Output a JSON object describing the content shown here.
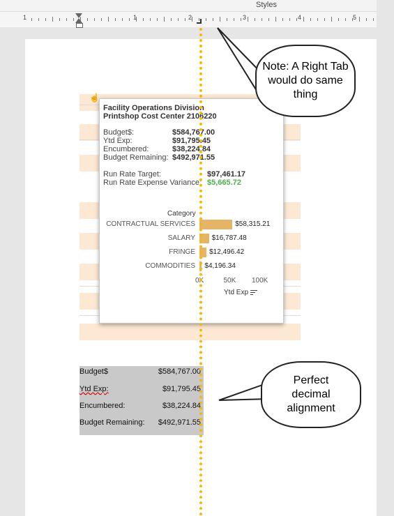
{
  "ribbon": {
    "styles_label": "Styles"
  },
  "ruler": {
    "numbers": [
      "1",
      "1",
      "2",
      "3",
      "4",
      "5"
    ]
  },
  "popup": {
    "title_line1": "Facility Operations Division",
    "title_line2": "Printshop Cost Center 2106220",
    "fields": [
      {
        "label": "Budget$:",
        "value": "$584,767.00"
      },
      {
        "label": "Ytd Exp:",
        "value": "$91,795.45"
      },
      {
        "label": "Encumbered:",
        "value": "$38,224.84"
      },
      {
        "label": "Budget Remaining:",
        "value": "$492,971.55"
      }
    ],
    "run_rate": [
      {
        "label": "Run Rate Target:",
        "value": "$97,461.17"
      },
      {
        "label": "Run Rate Expense Variance:",
        "value": "$5,665.72"
      }
    ],
    "chart_title": "Category",
    "axis_label": "Ytd Exp"
  },
  "chart_data": {
    "type": "bar",
    "orientation": "horizontal",
    "title": "Category",
    "xlabel": "Ytd Exp",
    "categories": [
      "CONTRACTUAL SERVICES",
      "SALARY",
      "FRINGE",
      "COMMODITIES"
    ],
    "values": [
      58315.21,
      16787.48,
      12496.42,
      4196.34
    ],
    "value_labels": [
      "$58,315.21",
      "$16,787.48",
      "$12,496.42",
      "$4,196.34"
    ],
    "xticks": [
      "0K",
      "50K",
      "100K"
    ],
    "xlim": [
      0,
      100000
    ],
    "bar_color": "#e5b467"
  },
  "table": {
    "rows": [
      {
        "label": "Budget$",
        "value": "$584,767.00"
      },
      {
        "label": "Ytd Exp:",
        "value": "$91,795.45"
      },
      {
        "label": "Encumbered:",
        "value": "$38,224.84"
      },
      {
        "label": "Budget Remaining:",
        "value": "$492,971.55"
      }
    ]
  },
  "callouts": {
    "top_note": "Note: A Right Tab would do same thing",
    "bottom_note": "Perfect decimal alignment"
  },
  "colors": {
    "tab_stop_line": "#f6b80f",
    "variance": "#4caf50",
    "row_band": "#fde8d4"
  }
}
